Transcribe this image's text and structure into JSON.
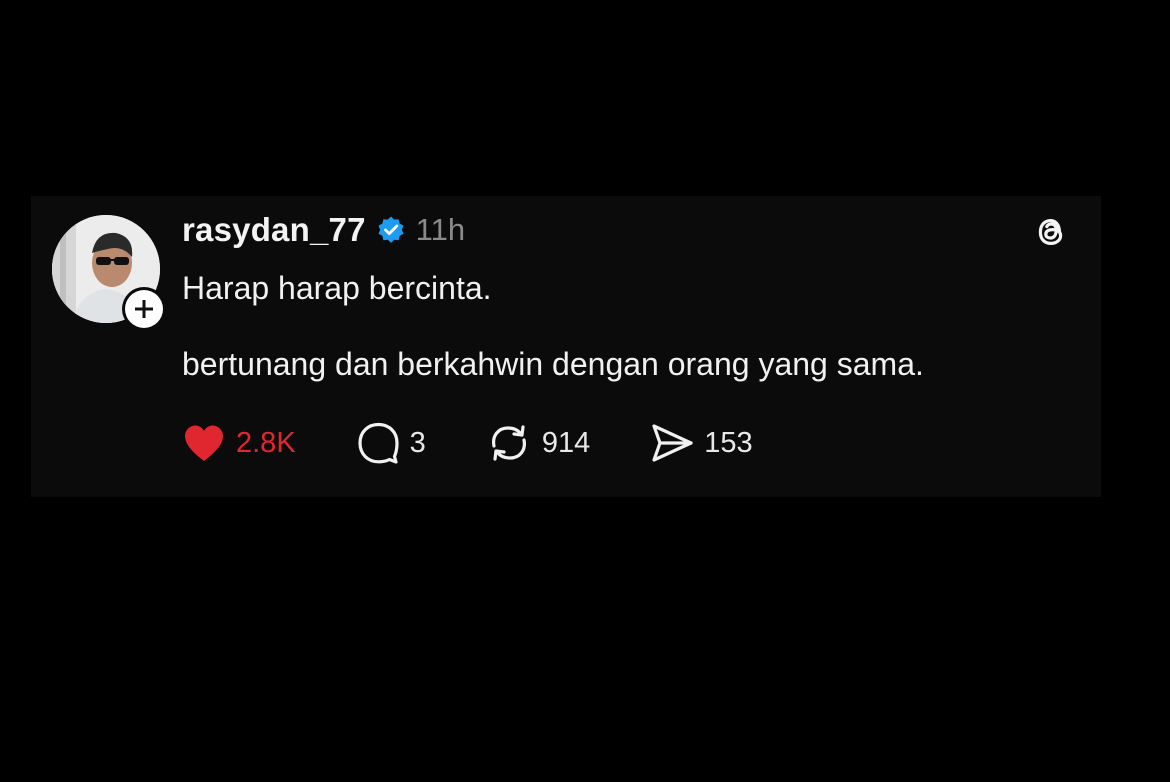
{
  "post": {
    "username": "rasydan_77",
    "time": "11h",
    "text_line1": "Harap harap bercinta.",
    "text_line2": "bertunang dan berkahwin dengan orang yang sama.",
    "likes": "2.8K",
    "replies": "3",
    "reposts": "914",
    "shares": "153"
  },
  "icons": {
    "verified": "verified-badge-icon",
    "threads": "threads-logo-icon",
    "like": "heart-icon",
    "reply": "speech-bubble-icon",
    "repost": "repost-arrows-icon",
    "share": "send-plane-icon",
    "follow": "plus-icon"
  },
  "colors": {
    "background": "#000000",
    "card": "#0b0b0b",
    "like": "#e0262f",
    "verified": "#1d9bf0",
    "muted_time": "#8a8a8a"
  }
}
